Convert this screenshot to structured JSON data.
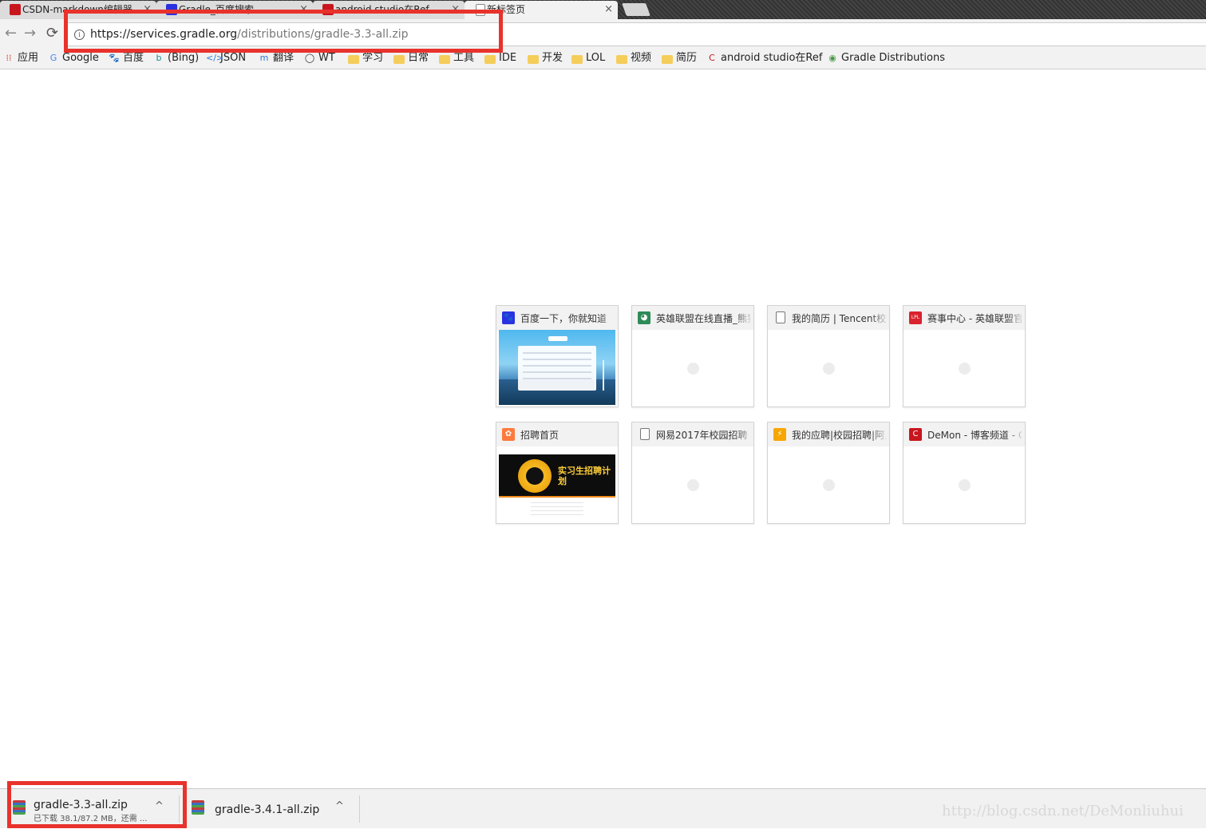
{
  "browser": {
    "tabs": [
      {
        "title": "CSDN-markdown编辑器",
        "close": "×",
        "favicon": "csdn-icon",
        "color": "#c8161e"
      },
      {
        "title": "Gradle_百度搜索",
        "close": "×",
        "favicon": "baidu-icon",
        "color": "#2932e1"
      },
      {
        "title": "android studio在Ref",
        "close": "×",
        "favicon": "csdn-icon",
        "color": "#c8161e"
      },
      {
        "title": "新标签页",
        "close": "×",
        "favicon": "page-icon",
        "color": "#777777"
      }
    ],
    "toolbar": {
      "back": "←",
      "forward": "→",
      "reload": "⟳",
      "url_host": "https://services.gradle.org",
      "url_path": "/distributions/gradle-3.3-all.zip",
      "info_icon": "i"
    },
    "bookmarks": [
      {
        "label": "应用",
        "icon": "apps-icon",
        "glyph": "⁞⁞",
        "color": "#e24a33"
      },
      {
        "label": "Google",
        "icon": "google-icon",
        "glyph": "G",
        "color": "#4285f4"
      },
      {
        "label": "百度",
        "icon": "baidu-icon",
        "glyph": "🐾",
        "color": "#2932e1"
      },
      {
        "label": "(Bing)",
        "icon": "bing-icon",
        "glyph": "b",
        "color": "#178b93"
      },
      {
        "label": "JSON",
        "icon": "json-icon",
        "glyph": "</>",
        "color": "#2b7bd6"
      },
      {
        "label": "翻译",
        "icon": "translate-icon",
        "glyph": "m",
        "color": "#2f7bd8"
      },
      {
        "label": "WT",
        "icon": "wt-icon",
        "glyph": "◯",
        "color": "#333333"
      },
      {
        "label": "学习",
        "icon": "folder-icon",
        "glyph": "",
        "color": "#f5cd5b"
      },
      {
        "label": "日常",
        "icon": "folder-icon",
        "glyph": "",
        "color": "#f5cd5b"
      },
      {
        "label": "工具",
        "icon": "folder-icon",
        "glyph": "",
        "color": "#f5cd5b"
      },
      {
        "label": "IDE",
        "icon": "folder-icon",
        "glyph": "",
        "color": "#f5cd5b"
      },
      {
        "label": "开发",
        "icon": "folder-icon",
        "glyph": "",
        "color": "#f5cd5b"
      },
      {
        "label": "LOL",
        "icon": "folder-icon",
        "glyph": "",
        "color": "#f5cd5b"
      },
      {
        "label": "视频",
        "icon": "folder-icon",
        "glyph": "",
        "color": "#f5cd5b"
      },
      {
        "label": "简历",
        "icon": "folder-icon",
        "glyph": "",
        "color": "#f5cd5b"
      },
      {
        "label": "android studio在Ref",
        "icon": "csdn-icon",
        "glyph": "C",
        "color": "#c8161e"
      },
      {
        "label": "Gradle Distributions",
        "icon": "gradle-icon",
        "glyph": "◉",
        "color": "#4a9a4a"
      }
    ]
  },
  "newtab": {
    "tiles": [
      {
        "title": "百度一下，你就知道",
        "icon": "baidu-paw-icon",
        "glyph": "🐾",
        "color": "#2932e1",
        "thumb": "baidu"
      },
      {
        "title": "英雄联盟在线直播_熊猫",
        "icon": "panda-icon",
        "glyph": "◕",
        "color": "#2e8b57",
        "thumb": ""
      },
      {
        "title": "我的简历 | Tencent校园招聘",
        "icon": "page-icon",
        "glyph": "",
        "color": "#ffffff",
        "thumb": ""
      },
      {
        "title": "赛事中心 - 英雄联盟官方网站",
        "icon": "lpl-icon",
        "glyph": "LPL",
        "color": "#d9232e",
        "thumb": ""
      },
      {
        "title": "招聘首页",
        "icon": "recruit-icon",
        "glyph": "✿",
        "color": "#ff7a3d",
        "thumb": "recruit"
      },
      {
        "title": "网易2017年校园招聘",
        "icon": "page-icon",
        "glyph": "",
        "color": "#ffffff",
        "thumb": ""
      },
      {
        "title": "我的应聘|校园招聘|阿里巴巴",
        "icon": "ali-icon",
        "glyph": "⚡",
        "color": "#f7a600",
        "thumb": ""
      },
      {
        "title": "DeMon - 博客频道 - CSDN",
        "icon": "csdn-icon",
        "glyph": "C",
        "color": "#c8161e",
        "thumb": ""
      }
    ],
    "recruit_banner": "实习生招聘计划"
  },
  "downloads": [
    {
      "name": "gradle-3.3-all.zip",
      "status": "已下载 38.1/87.2 MB，还需 ...",
      "chevron": "^"
    },
    {
      "name": "gradle-3.4.1-all.zip",
      "status": "",
      "chevron": "^"
    }
  ],
  "watermark": "http://blog.csdn.net/DeMonliuhui",
  "highlight_color": "#e8322c"
}
